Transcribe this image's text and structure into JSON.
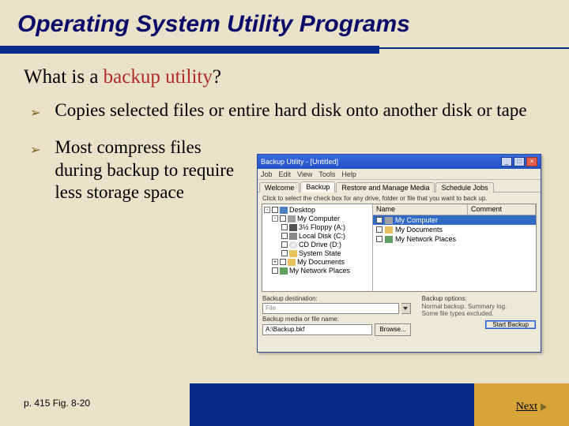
{
  "title": "Operating System Utility Programs",
  "subtitle_prefix": "What is a ",
  "subtitle_em": "backup utility",
  "subtitle_suffix": "?",
  "bullets": [
    "Copies selected files or entire hard disk onto another disk or tape",
    "Most compress files during backup to require less storage space"
  ],
  "page_ref": "p. 415 Fig. 8-20",
  "next_label": "Next",
  "app": {
    "title": "Backup Utility - [Untitled]",
    "menu": [
      "Job",
      "Edit",
      "View",
      "Tools",
      "Help"
    ],
    "tabs": [
      "Welcome",
      "Backup",
      "Restore and Manage Media",
      "Schedule Jobs"
    ],
    "active_tab": 1,
    "instruction": "Click to select the check box for any drive, folder or file that you want to back up.",
    "tree": [
      {
        "indent": 0,
        "toggle": "-",
        "label": "Desktop",
        "icon": "desktop"
      },
      {
        "indent": 1,
        "toggle": "-",
        "label": "My Computer",
        "icon": "computer"
      },
      {
        "indent": 2,
        "toggle": "",
        "label": "3½ Floppy (A:)",
        "icon": "floppy"
      },
      {
        "indent": 2,
        "toggle": "",
        "label": "Local Disk (C:)",
        "icon": "diskc"
      },
      {
        "indent": 2,
        "toggle": "",
        "label": "CD Drive (D:)",
        "icon": "cd"
      },
      {
        "indent": 2,
        "toggle": "",
        "label": "System State",
        "icon": "folder"
      },
      {
        "indent": 1,
        "toggle": "+",
        "label": "My Documents",
        "icon": "folder"
      },
      {
        "indent": 1,
        "toggle": "",
        "label": "My Network Places",
        "icon": "net"
      }
    ],
    "list_headers": [
      "Name",
      "Comment"
    ],
    "list_rows": [
      {
        "label": "My Computer",
        "icon": "computer",
        "selected": true
      },
      {
        "label": "My Documents",
        "icon": "folder",
        "selected": false
      },
      {
        "label": "My Network Places",
        "icon": "net",
        "selected": false
      }
    ],
    "dest_label": "Backup destination:",
    "dest_value": "File",
    "media_label": "Backup media or file name:",
    "media_value": "A:\\Backup.bkf",
    "browse_label": "Browse...",
    "options_label": "Backup options:",
    "options_text1": "Normal backup. Summary log.",
    "options_text2": "Some file types excluded.",
    "start_label": "Start Backup"
  }
}
